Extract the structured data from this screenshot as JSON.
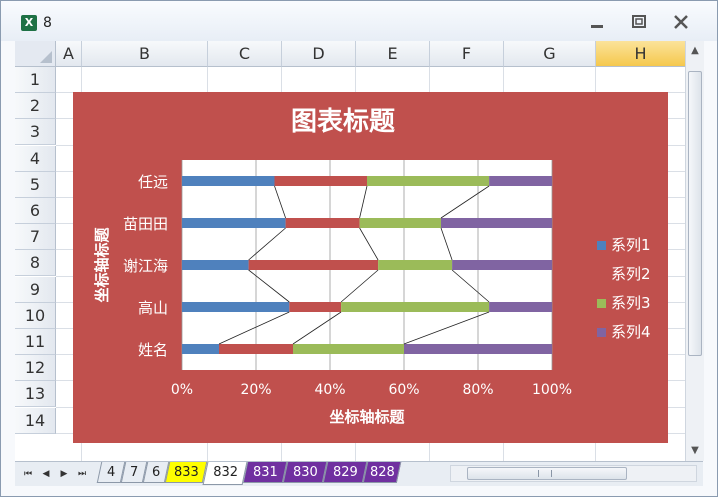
{
  "window": {
    "title": "8",
    "app_icon": "X"
  },
  "columns": [
    "A",
    "B",
    "C",
    "D",
    "E",
    "F",
    "G",
    "H"
  ],
  "selected_column": "H",
  "rows": [
    "1",
    "2",
    "3",
    "4",
    "5",
    "6",
    "7",
    "8",
    "9",
    "10",
    "11",
    "12",
    "13",
    "14"
  ],
  "chart_data": {
    "type": "bar",
    "stacked": "percent",
    "orientation": "horizontal",
    "title": "图表标题",
    "xlabel": "坐标轴标题",
    "ylabel": "坐标轴标题",
    "categories": [
      "姓名",
      "高山",
      "谢江海",
      "苗田田",
      "任远"
    ],
    "x_ticks": [
      "0%",
      "20%",
      "40%",
      "60%",
      "80%",
      "100%"
    ],
    "xlim": [
      0,
      1
    ],
    "grid": true,
    "series_lines": true,
    "legend_position": "right",
    "series": [
      {
        "name": "系列1",
        "color": "#4f81bd",
        "values": [
          0.1,
          0.29,
          0.18,
          0.28,
          0.25
        ]
      },
      {
        "name": "系列2",
        "color": "#c0504d",
        "values": [
          0.2,
          0.14,
          0.35,
          0.2,
          0.25
        ]
      },
      {
        "name": "系列3",
        "color": "#9bbb59",
        "values": [
          0.3,
          0.4,
          0.2,
          0.22,
          0.33
        ]
      },
      {
        "name": "系列4",
        "color": "#8064a2",
        "values": [
          0.4,
          0.17,
          0.27,
          0.3,
          0.17
        ]
      }
    ]
  },
  "sheet_tabs": [
    {
      "label": "4",
      "active": false,
      "color": ""
    },
    {
      "label": "7",
      "active": false,
      "color": ""
    },
    {
      "label": "6",
      "active": false,
      "color": ""
    },
    {
      "label": "833",
      "active": false,
      "color": "#ffff00"
    },
    {
      "label": "832",
      "active": true,
      "color": ""
    },
    {
      "label": "831",
      "active": false,
      "color": "#7030a0"
    },
    {
      "label": "830",
      "active": false,
      "color": "#7030a0"
    },
    {
      "label": "829",
      "active": false,
      "color": "#7030a0"
    },
    {
      "label": "828",
      "active": false,
      "color": "#7030a0"
    }
  ]
}
